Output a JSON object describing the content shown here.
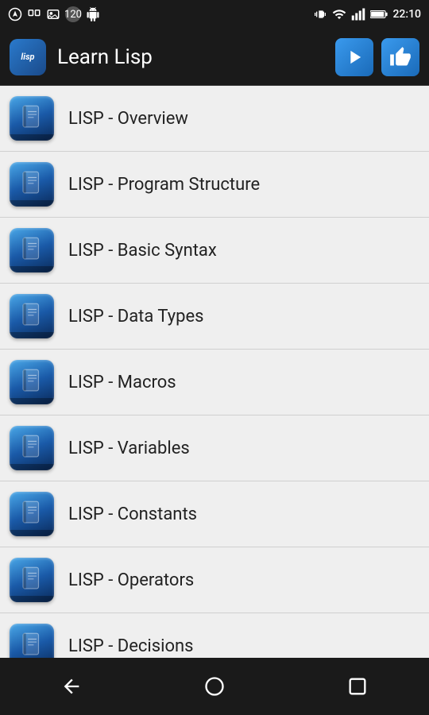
{
  "statusBar": {
    "time": "22:10",
    "icons": [
      "notification",
      "sync",
      "image",
      "120",
      "android"
    ]
  },
  "appBar": {
    "logoText": "lisp",
    "title": "Learn Lisp",
    "playButtonLabel": "play",
    "thumbButtonLabel": "thumbs-up"
  },
  "listItems": [
    {
      "id": 1,
      "label": "LISP - Overview"
    },
    {
      "id": 2,
      "label": "LISP - Program Structure"
    },
    {
      "id": 3,
      "label": "LISP - Basic Syntax"
    },
    {
      "id": 4,
      "label": "LISP - Data Types"
    },
    {
      "id": 5,
      "label": "LISP - Macros"
    },
    {
      "id": 6,
      "label": "LISP - Variables"
    },
    {
      "id": 7,
      "label": "LISP - Constants"
    },
    {
      "id": 8,
      "label": "LISP - Operators"
    },
    {
      "id": 9,
      "label": "LISP - Decisions"
    }
  ],
  "bottomNav": {
    "backLabel": "back",
    "homeLabel": "home",
    "recentLabel": "recent"
  }
}
